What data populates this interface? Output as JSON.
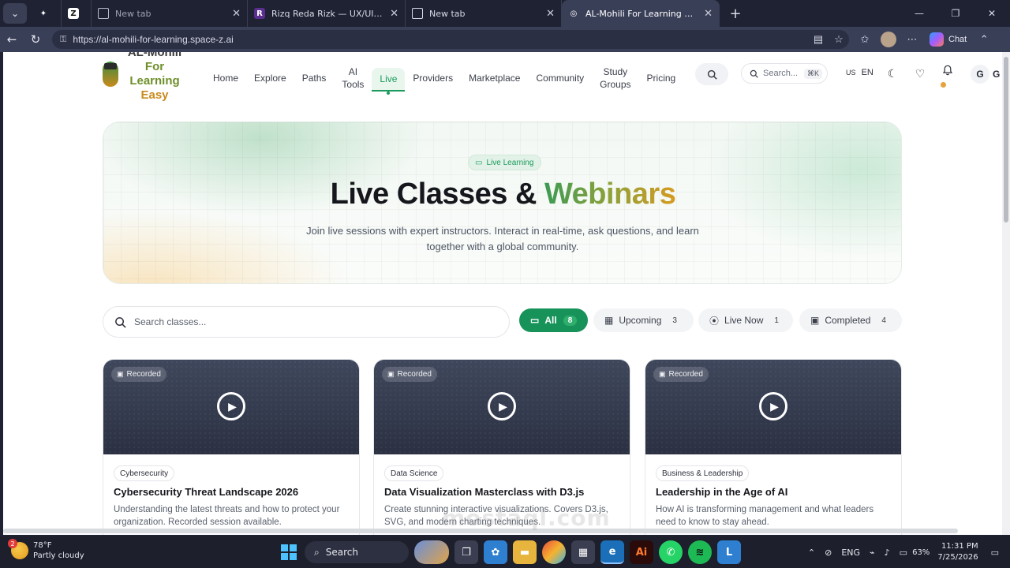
{
  "browser": {
    "tabs": [
      {
        "label": "",
        "icon": "figma-icon"
      },
      {
        "label": "",
        "icon": "z-icon"
      },
      {
        "label": "New tab",
        "icon": "newtab-icon"
      },
      {
        "label": "Rizq Reda Rizk — UX/UI & Produc",
        "icon": "site-icon"
      },
      {
        "label": "New tab",
        "icon": "newtab-icon"
      },
      {
        "label": "AL-Mohili For Learning Easy — Ent",
        "icon": "globe-icon",
        "active": true
      }
    ],
    "url": "https://al-mohili-for-learning.space-z.ai",
    "chat_label": "Chat"
  },
  "site": {
    "logo": {
      "line1": "AL-Mohili",
      "line2": "For",
      "line3": "Learning",
      "line4": "Easy"
    },
    "nav": {
      "home": "Home",
      "explore": "Explore",
      "paths": "Paths",
      "ai_tools_1": "AI",
      "ai_tools_2": "Tools",
      "live": "Live",
      "providers": "Providers",
      "marketplace": "Marketplace",
      "community": "Community",
      "study_groups_1": "Study",
      "study_groups_2": "Groups",
      "pricing": "Pricing"
    },
    "search": {
      "label": "Search...",
      "shortcut": "⌘K"
    },
    "lang": {
      "flag": "US",
      "code": "EN"
    },
    "user_initial": "G",
    "user_initial_2": "G"
  },
  "hero": {
    "badge": "Live Learning",
    "title_main": "Live Classes &",
    "title_accent": "Webinars",
    "subtitle": "Join live sessions with expert instructors. Interact in real-time, ask questions, and learn together with a global community."
  },
  "filters": {
    "search_placeholder": "Search classes...",
    "chips": [
      {
        "label": "All",
        "count": "8",
        "active": true
      },
      {
        "label": "Upcoming",
        "count": "3"
      },
      {
        "label": "Live Now",
        "count": "1"
      },
      {
        "label": "Completed",
        "count": "4"
      }
    ]
  },
  "cards": [
    {
      "badge": "Recorded",
      "category": "Cybersecurity",
      "title": "Cybersecurity Threat Landscape 2026",
      "description": "Understanding the latest threats and how to protect your organization. Recorded session available."
    },
    {
      "badge": "Recorded",
      "category": "Data Science",
      "title": "Data Visualization Masterclass with D3.js",
      "description": "Create stunning interactive visualizations. Covers D3.js, SVG, and modern charting techniques."
    },
    {
      "badge": "Recorded",
      "category": "Business & Leadership",
      "title": "Leadership in the Age of AI",
      "description": "How AI is transforming management and what leaders need to know to stay ahead."
    }
  ],
  "taskbar": {
    "weather_temp": "78°F",
    "weather_desc": "Partly cloudy",
    "weather_badge": "2",
    "search_label": "Search",
    "lang": "ENG",
    "battery": "63%",
    "time": "11:31 PM",
    "date": "7/25/2026"
  },
  "watermark": "mostaql.com",
  "colors": {
    "accent": "#17935a",
    "accent_light": "#e8f6ee",
    "brand_gold": "#c98b1d"
  }
}
